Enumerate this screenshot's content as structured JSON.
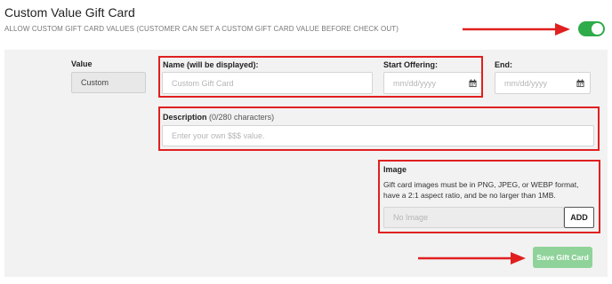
{
  "header": {
    "title": "Custom Value Gift Card",
    "subtitle": "ALLOW CUSTOM GIFT CARD VALUES (CUSTOMER CAN SET A CUSTOM GIFT CARD VALUE BEFORE CHECK OUT)",
    "toggle_on": true
  },
  "form": {
    "value_label": "Value",
    "value_text": "Custom",
    "name_label": "Name (will be displayed):",
    "name_placeholder": "Custom Gift Card",
    "start_label": "Start Offering:",
    "start_placeholder": "mm/dd/yyyy",
    "end_label": "End:",
    "end_placeholder": "mm/dd/yyyy",
    "description_label": "Description",
    "description_count": "(0/280 characters)",
    "description_placeholder": "Enter your own $$$ value.",
    "image_label": "Image",
    "image_desc": "Gift card images must be in PNG, JPEG, or WEBP format, have a 2:1 aspect ratio, and be no larger than 1MB.",
    "image_placeholder": "No Image",
    "add_label": "ADD",
    "save_label": "Save Gift Card"
  },
  "colors": {
    "accent": "#2eab4a",
    "save_disabled": "#8fd39a",
    "annotation": "#e02020",
    "panel": "#f2f2f2"
  },
  "icons": [
    "calendar-icon",
    "arrow-right-icon"
  ]
}
